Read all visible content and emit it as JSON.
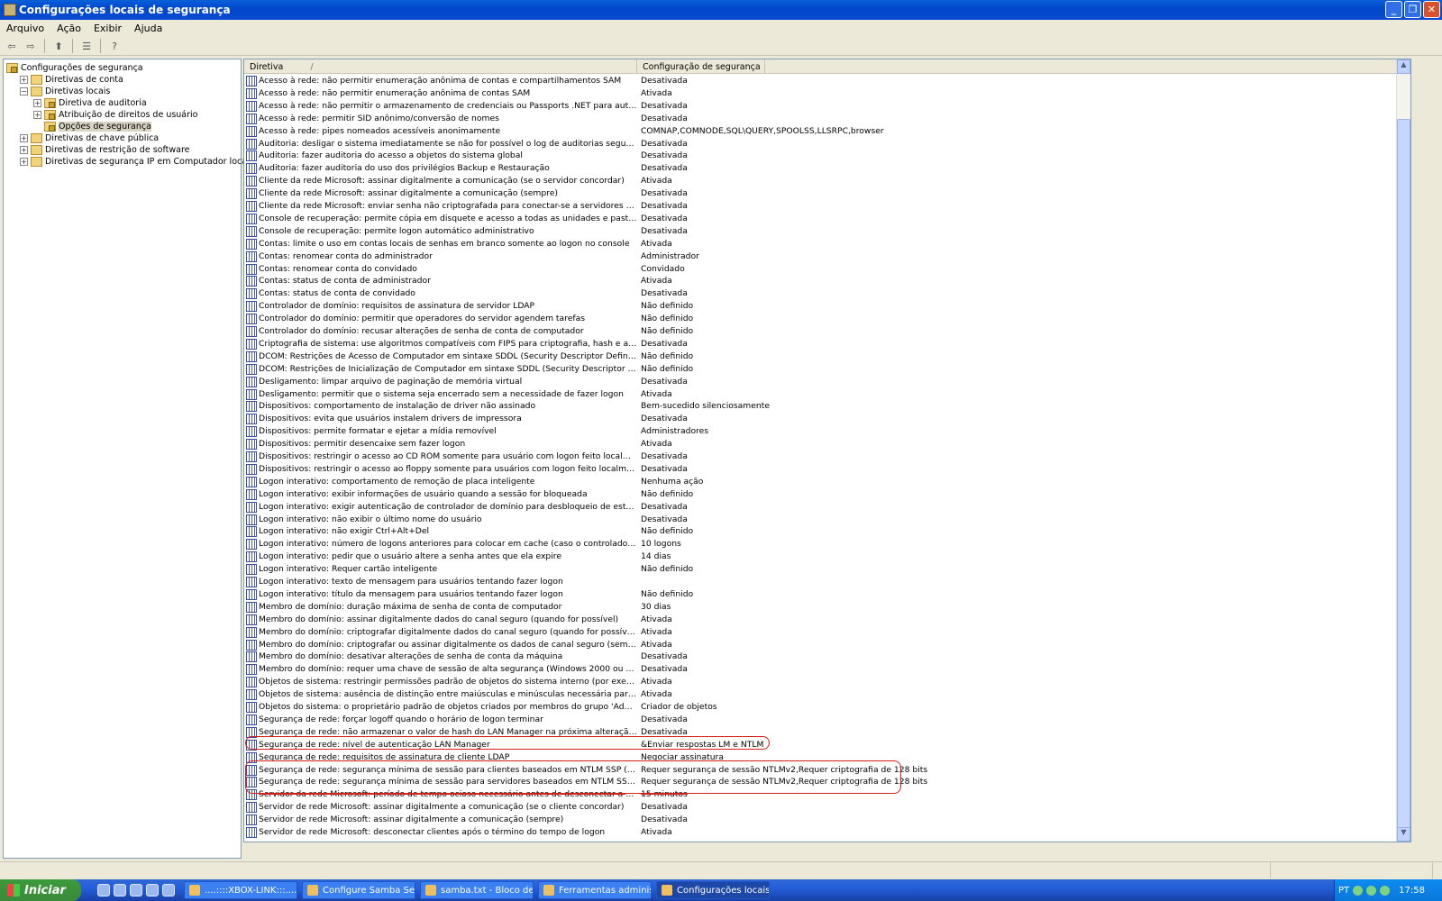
{
  "window": {
    "title": "Configurações locais de segurança"
  },
  "menu": [
    "Arquivo",
    "Ação",
    "Exibir",
    "Ajuda"
  ],
  "tree": [
    {
      "label": "Configurações de segurança",
      "level": 0,
      "expander": ""
    },
    {
      "label": "Diretivas de conta",
      "level": 1,
      "expander": "+"
    },
    {
      "label": "Diretivas locais",
      "level": 1,
      "expander": "−"
    },
    {
      "label": "Diretiva de auditoria",
      "level": 2,
      "expander": "+"
    },
    {
      "label": "Atribuição de direitos de usuário",
      "level": 2,
      "expander": "+"
    },
    {
      "label": "Opções de segurança",
      "level": 2,
      "expander": "",
      "selected": true
    },
    {
      "label": "Diretivas de chave pública",
      "level": 1,
      "expander": "+"
    },
    {
      "label": "Diretivas de restrição de software",
      "level": 1,
      "expander": "+"
    },
    {
      "label": "Diretivas de segurança IP em Computador local",
      "level": 1,
      "expander": "+"
    }
  ],
  "columns": [
    "Diretiva",
    "Configuração de segurança"
  ],
  "rows": [
    [
      "Acesso à rede: não permitir enumeração anônima de contas e compartilhamentos SAM",
      "Desativada"
    ],
    [
      "Acesso à rede: não permitir enumeração anônima de contas SAM",
      "Ativada"
    ],
    [
      "Acesso à rede: não permitir o armazenamento de credenciais ou Passports .NET para autenticação de r...",
      "Desativada"
    ],
    [
      "Acesso à rede: permitir SID anônimo/conversão de nomes",
      "Desativada"
    ],
    [
      "Acesso à rede: pipes nomeados acessíveis anonimamente",
      "COMNAP,COMNODE,SQL\\QUERY,SPOOLSS,LLSRPC,browser"
    ],
    [
      "Auditoria: desligar o sistema imediatamente se não for possível o log de auditorias seguras",
      "Desativada"
    ],
    [
      "Auditoria: fazer auditoria do acesso a objetos do sistema global",
      "Desativada"
    ],
    [
      "Auditoria: fazer auditoria do uso dos privilégios Backup e Restauração",
      "Desativada"
    ],
    [
      "Cliente da rede Microsoft: assinar digitalmente a comunicação (se o servidor concordar)",
      "Ativada"
    ],
    [
      "Cliente da rede Microsoft: assinar digitalmente a comunicação (sempre)",
      "Desativada"
    ],
    [
      "Cliente da rede Microsoft: enviar senha não criptografada para conectar-se a servidores SMB de outro f...",
      "Desativada"
    ],
    [
      "Console de recuperação: permite cópia em disquete e acesso a todas as unidades e pastas",
      "Desativada"
    ],
    [
      "Console de recuperação: permite logon automático administrativo",
      "Desativada"
    ],
    [
      "Contas: limite o uso em contas locais de senhas em branco somente ao logon no console",
      "Ativada"
    ],
    [
      "Contas: renomear conta do administrador",
      "Administrador"
    ],
    [
      "Contas: renomear conta do convidado",
      "Convidado"
    ],
    [
      "Contas: status de conta de administrador",
      "Ativada"
    ],
    [
      "Contas: status de conta de convidado",
      "Desativada"
    ],
    [
      "Controlador de domínio: requisitos de assinatura de servidor LDAP",
      "Não definido"
    ],
    [
      "Controlador do domínio: permitir que operadores do servidor agendem tarefas",
      "Não definido"
    ],
    [
      "Controlador do domínio: recusar alterações de senha de conta de computador",
      "Não definido"
    ],
    [
      "Criptografia de sistema: use algoritmos compatíveis com FIPS para criptografia, hash e assinatura",
      "Desativada"
    ],
    [
      "DCOM: Restrições de Acesso de Computador em sintaxe SDDL (Security Descriptor Definition Language)",
      "Não definido"
    ],
    [
      "DCOM: Restrições de Inicialização de Computador em sintaxe SDDL (Security Descriptor Definition Langu...",
      "Não definido"
    ],
    [
      "Desligamento: limpar arquivo de paginação de memória virtual",
      "Desativada"
    ],
    [
      "Desligamento: permitir que o sistema seja encerrado sem a necessidade de fazer logon",
      "Ativada"
    ],
    [
      "Dispositivos: comportamento de instalação de driver não assinado",
      "Bem-sucedido silenciosamente"
    ],
    [
      "Dispositivos: evita que usuários instalem drivers de impressora",
      "Desativada"
    ],
    [
      "Dispositivos: permite formatar e ejetar a mídia removível",
      "Administradores"
    ],
    [
      "Dispositivos: permitir desencaixe sem fazer logon",
      "Ativada"
    ],
    [
      "Dispositivos: restringir o acesso ao CD ROM somente para usuário com logon feito localmente",
      "Desativada"
    ],
    [
      "Dispositivos: restringir o acesso ao floppy somente para usuários com logon feito localmente",
      "Desativada"
    ],
    [
      "Logon interativo: comportamento de remoção de placa inteligente",
      "Nenhuma ação"
    ],
    [
      "Logon interativo: exibir informações de usuário quando a sessão for bloqueada",
      "Não definido"
    ],
    [
      "Logon interativo: exigir autenticação de controlador de domínio para desbloqueio de estação de trabalho",
      "Desativada"
    ],
    [
      "Logon interativo: não exibir o último nome do usuário",
      "Desativada"
    ],
    [
      "Logon interativo: não exigir Ctrl+Alt+Del",
      "Não definido"
    ],
    [
      "Logon interativo: número de logons anteriores para colocar em cache (caso o controlador de domínio nã...",
      "10 logons"
    ],
    [
      "Logon interativo: pedir que o usuário altere a senha antes que ela expire",
      "14 dias"
    ],
    [
      "Logon interativo: Requer cartão inteligente",
      "Não definido"
    ],
    [
      "Logon interativo: texto de mensagem para usuários tentando fazer logon",
      ""
    ],
    [
      "Logon interativo: título da mensagem para usuários tentando fazer logon",
      "Não definido"
    ],
    [
      "Membro de domínio: duração máxima de senha de conta de computador",
      "30 dias"
    ],
    [
      "Membro do domínio: assinar digitalmente dados do canal seguro (quando for possível)",
      "Ativada"
    ],
    [
      "Membro do domínio: criptografar digitalmente dados do canal seguro (quando for possível)",
      "Ativada"
    ],
    [
      "Membro do domínio: criptografar ou assinar digitalmente os dados de canal seguro (sempre)",
      "Ativada"
    ],
    [
      "Membro do domínio: desativar alterações de senha de conta da máquina",
      "Desativada"
    ],
    [
      "Membro do domínio: requer uma chave de sessão de alta segurança (Windows 2000 ou posterior)",
      "Desativada"
    ],
    [
      "Objetos de sistema: restringir permissões padrão de objetos do sistema interno (por exemplo: Ligações ...",
      "Ativada"
    ],
    [
      "Objetos de sistema: ausência de distinção entre maiúsculas e minúsculas necessária para subsistemas n...",
      "Ativada"
    ],
    [
      "Objetos do sistema: o proprietário padrão de objetos criados por membros do grupo 'Administradores'",
      "Criador de objetos"
    ],
    [
      "Segurança de rede: forçar logoff quando o horário de logon terminar",
      "Desativada"
    ],
    [
      "Segurança de rede: não armazenar o valor de hash do LAN Manager na próxima alteração de senha",
      "Desativada"
    ],
    [
      "Segurança de rede: nível de autenticação LAN Manager",
      "&Enviar respostas LM e NTLM"
    ],
    [
      "Segurança de rede: requisitos de assinatura de cliente LDAP",
      "Negociar assinatura"
    ],
    [
      "Segurança de rede: segurança mínima de sessão para clientes baseados em NTLM SSP (incluindo RPC se...",
      "Requer segurança de sessão NTLMv2,Requer criptografia de 128 bits"
    ],
    [
      "Segurança de rede: segurança mínima de sessão para servidores baseados em NTLM SSP (incluindo RPC...",
      "Requer segurança de sessão NTLMv2,Requer criptografia de 128 bits"
    ],
    [
      "Servidor da rede Microsoft: período de tempo ocioso necessário antes de desconectar a sessão",
      "15 minutos"
    ],
    [
      "Servidor de rede Microsoft: assinar digitalmente a comunicação (se o cliente concordar)",
      "Desativada"
    ],
    [
      "Servidor de rede Microsoft: assinar digitalmente a comunicação (sempre)",
      "Desativada"
    ],
    [
      "Servidor de rede Microsoft: desconectar clientes após o término do tempo de logon",
      "Ativada"
    ]
  ],
  "taskbar": {
    "start": "Iniciar",
    "tasks": [
      "....::::XBOX-LINK:::....",
      "Configure Samba Ser...",
      "samba.txt - Bloco de ...",
      "Ferramentas administ...",
      "Configurações locais ..."
    ],
    "lang": "PT",
    "clock": "17:58"
  }
}
